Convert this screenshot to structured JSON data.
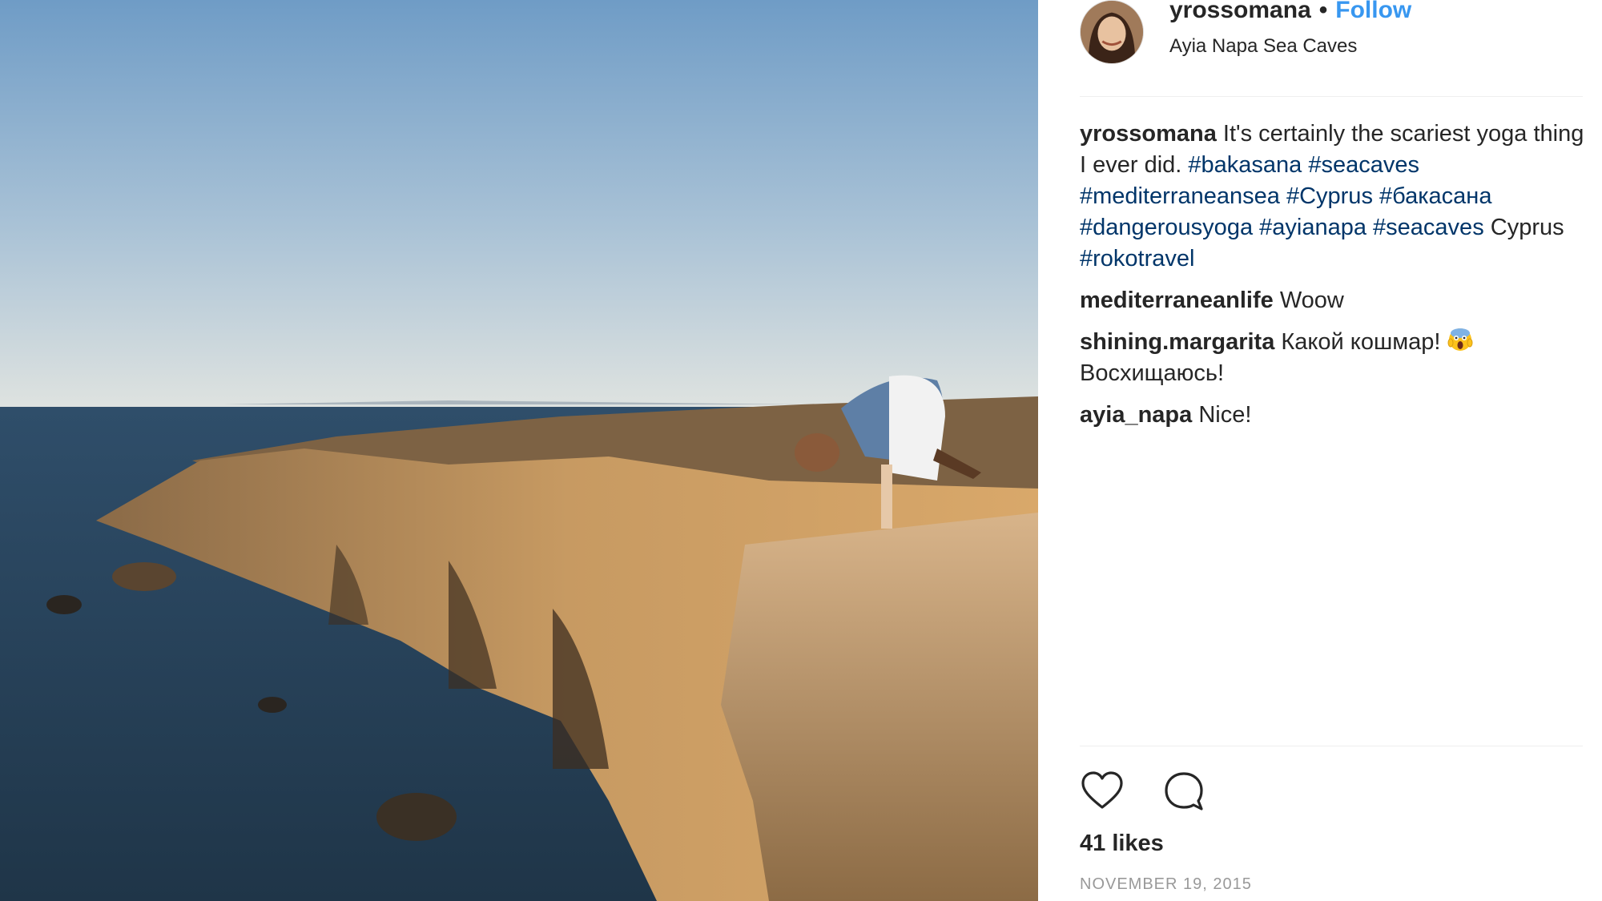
{
  "post": {
    "username": "yrossomana",
    "separator": "•",
    "follow_label": "Follow",
    "location": "Ayia Napa Sea Caves",
    "photo_alt": "photo"
  },
  "comments": [
    {
      "user": "yrossomana",
      "parts": [
        {
          "t": "text",
          "v": " It's certainly the scariest yoga thing I ever did. "
        },
        {
          "t": "tag",
          "v": "#bakasana"
        },
        {
          "t": "text",
          "v": " "
        },
        {
          "t": "tag",
          "v": "#seacaves"
        },
        {
          "t": "text",
          "v": " "
        },
        {
          "t": "tag",
          "v": "#mediterraneansea"
        },
        {
          "t": "text",
          "v": " "
        },
        {
          "t": "tag",
          "v": "#Cyprus"
        },
        {
          "t": "text",
          "v": " "
        },
        {
          "t": "tag",
          "v": "#бакасана"
        },
        {
          "t": "text",
          "v": " "
        },
        {
          "t": "tag",
          "v": "#dangerousyoga"
        },
        {
          "t": "text",
          "v": " "
        },
        {
          "t": "tag",
          "v": "#ayianapa"
        },
        {
          "t": "text",
          "v": " "
        },
        {
          "t": "tag",
          "v": "#seacaves"
        },
        {
          "t": "text",
          "v": " Cyprus "
        },
        {
          "t": "tag",
          "v": "#rokotravel"
        }
      ]
    },
    {
      "user": "mediterraneanlife",
      "parts": [
        {
          "t": "text",
          "v": " Woow"
        }
      ]
    },
    {
      "user": "shining.margarita",
      "parts": [
        {
          "t": "text",
          "v": " Какой кошмар! "
        },
        {
          "t": "emoji",
          "v": "screaming-face"
        },
        {
          "t": "text",
          "v": " Восхищаюсь!"
        }
      ]
    },
    {
      "user": "ayia_napa",
      "parts": [
        {
          "t": "text",
          "v": " Nice!"
        }
      ]
    }
  ],
  "actions": {
    "like_icon": "heart-outline-icon",
    "comment_icon": "speech-bubble-icon"
  },
  "likes_label": "41 likes",
  "date_label": "NOVEMBER 19, 2015",
  "colors": {
    "follow": "#3897f0",
    "hashtag": "#003569",
    "date": "#999999"
  }
}
